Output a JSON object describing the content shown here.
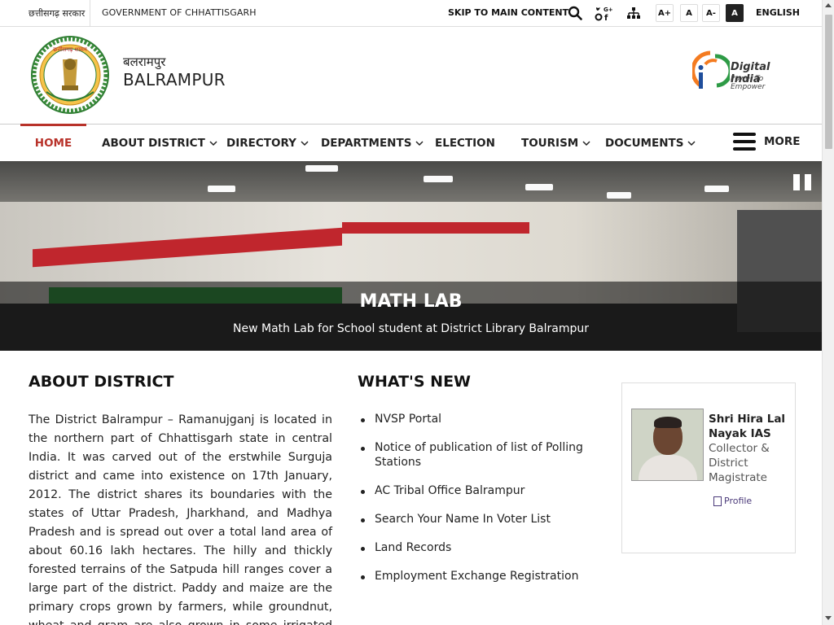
{
  "topbar": {
    "gov_hindi": "छत्तीसगढ़ सरकार",
    "gov_english": "GOVERNMENT OF CHHATTISGARH",
    "skip": "SKIP TO MAIN CONTENT",
    "font_sizes": [
      "A+",
      "A",
      "A-",
      "A"
    ],
    "language": "ENGLISH",
    "social_icon_text": "G+"
  },
  "header": {
    "site_hindi": "बलरामपुर",
    "site_english": "BALRAMPUR",
    "digital_india": "Digital India",
    "digital_india_tag": "Power To Empower"
  },
  "nav": {
    "items": [
      {
        "label": "HOME",
        "active": true
      },
      {
        "label": "ABOUT DISTRICT",
        "dropdown": true
      },
      {
        "label": "DIRECTORY",
        "dropdown": true
      },
      {
        "label": "DEPARTMENTS",
        "dropdown": true
      },
      {
        "label": "ELECTION",
        "dropdown": false
      },
      {
        "label": "TOURISM",
        "dropdown": true
      },
      {
        "label": "DOCUMENTS",
        "dropdown": true
      }
    ],
    "more": "MORE"
  },
  "banner": {
    "title": "MATH LAB",
    "subtitle": "New Math Lab for School student at District Library Balrampur"
  },
  "about": {
    "title": "ABOUT DISTRICT",
    "text": "The District Balrampur – Ramanujganj is located in the northern part of Chhattisgarh state in central India. It was carved out of the erstwhile Surguja district and came into existence on 17th January, 2012. The district shares its boundaries with the states of Uttar Pradesh, Jharkhand, and Madhya Pradesh and is spread out over a total land area of about 60.16 lakh hectares. The hilly and thickly forested terrains of the Satpuda hill ranges cover a large part of the district. Paddy and maize are the primary crops grown by farmers, while groundnut, wheat and gram are also grown in some irrigated parts of the district."
  },
  "whats_new": {
    "title": "WHAT'S NEW",
    "items": [
      "NVSP Portal",
      "Notice of publication of list of Polling Stations",
      "AC Tribal Office Balrampur",
      "Search Your Name In Voter List",
      "Land Records",
      "Employment Exchange Registration"
    ]
  },
  "profile": {
    "name": "Shri Hira Lal Nayak IAS",
    "role": "Collector & District Magistrate",
    "link": "Profile"
  },
  "colors": {
    "accent_red": "#b8322a",
    "text": "#222222"
  }
}
